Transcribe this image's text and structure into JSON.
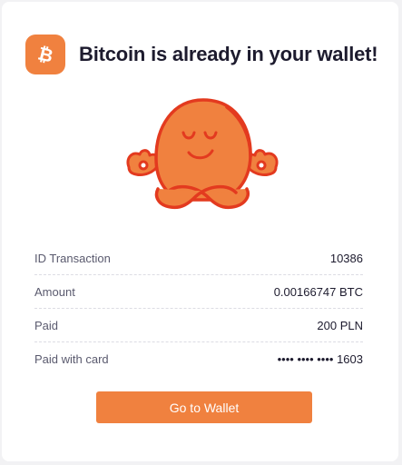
{
  "header": {
    "title": "Bitcoin is already in your wallet!",
    "badge_symbol": "₿",
    "badge_icon": "bitcoin-icon"
  },
  "illustration": {
    "icon": "happy-meditating-mascot"
  },
  "colors": {
    "accent": "#f0813f",
    "mascot_fill": "#f0813f",
    "mascot_outline": "#e33a1f",
    "title_text": "#1d1b2e",
    "label_text": "#5a5a6e",
    "background": "#f2f2f4",
    "card": "#ffffff"
  },
  "details": {
    "rows": [
      {
        "label": "ID Transaction",
        "value": "10386"
      },
      {
        "label": "Amount",
        "value": "0.00166747 BTC"
      },
      {
        "label": "Paid",
        "value": "200 PLN"
      },
      {
        "label": "Paid with card",
        "value": "•••• •••• •••• 1603"
      }
    ]
  },
  "actions": {
    "go_to_wallet_label": "Go to Wallet"
  }
}
